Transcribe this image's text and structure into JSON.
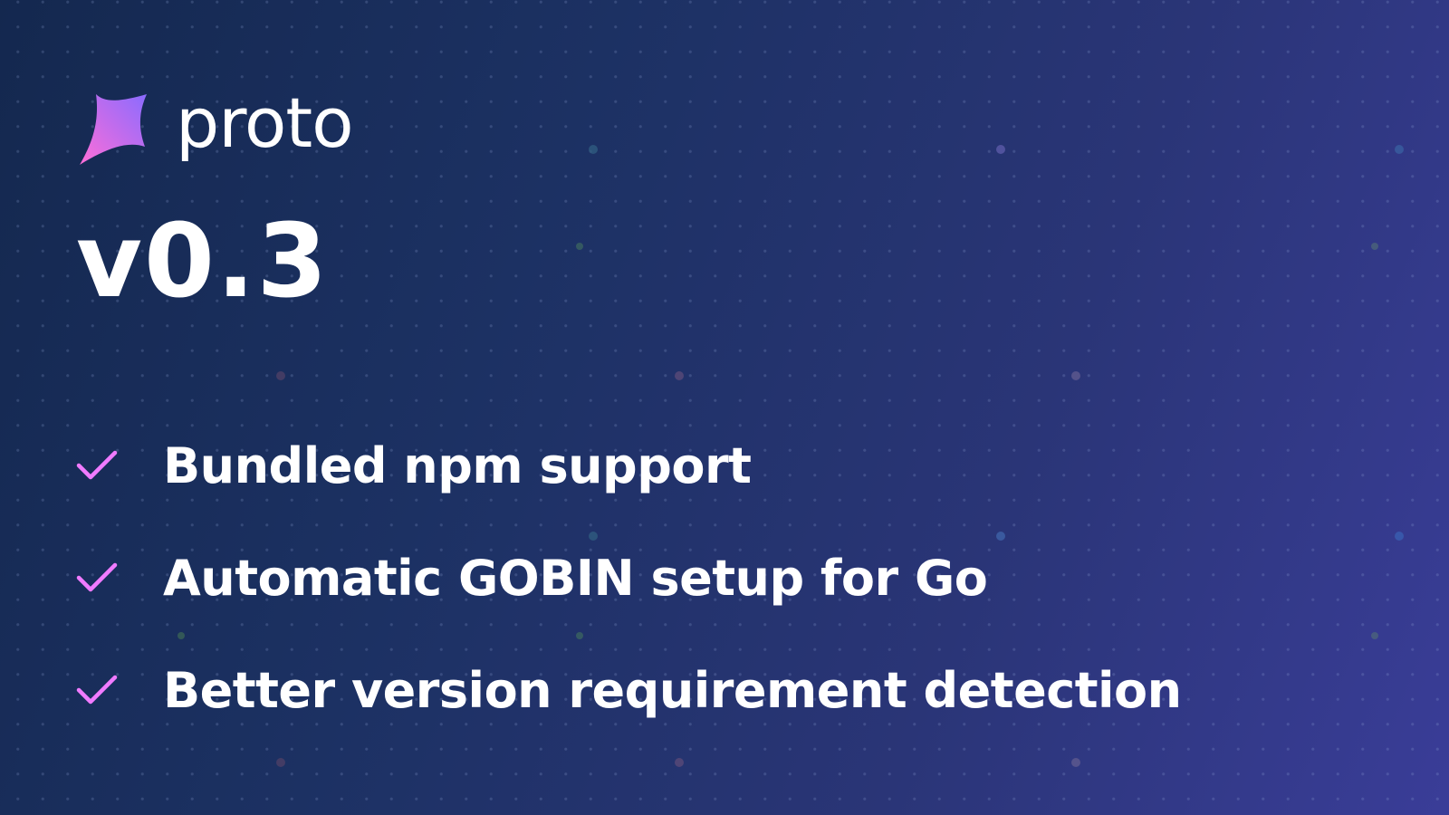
{
  "brand": {
    "name": "proto",
    "logo_icon": "proto-star-logo-icon",
    "logo_gradient": [
      "#ff6ed8",
      "#8a6bff"
    ]
  },
  "release": {
    "version": "v0.3"
  },
  "features": [
    {
      "icon": "check-icon",
      "label": "Bundled npm support"
    },
    {
      "icon": "check-icon",
      "label": "Automatic GOBIN setup for Go"
    },
    {
      "icon": "check-icon",
      "label": "Better version requirement detection"
    }
  ],
  "colors": {
    "background_start": "#14284f",
    "background_end": "#3a3d98",
    "check": "#f07bff",
    "text": "#ffffff"
  }
}
